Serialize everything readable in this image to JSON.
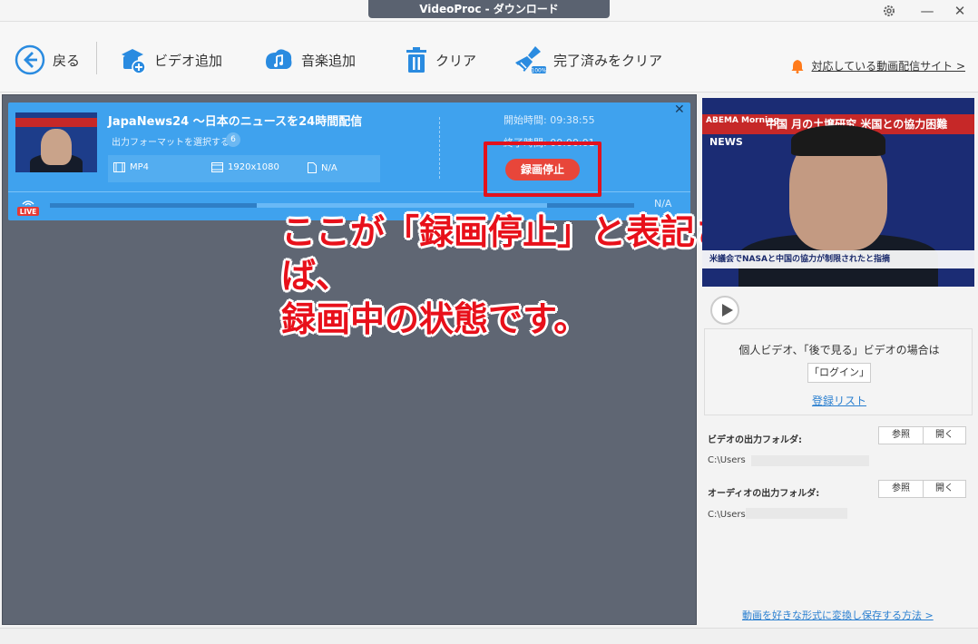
{
  "window": {
    "title": "VideoProc - ダウンロード"
  },
  "toolbar": {
    "back_label": "戻る",
    "add_video_label": "ビデオ追加",
    "add_music_label": "音楽追加",
    "clear_label": "クリア",
    "clear_done_label": "完了済みをクリア",
    "site_link": "対応している動画配信サイト >"
  },
  "task": {
    "title": "JapaNews24 〜日本のニュースを24時間配信",
    "format_label": "出力フォーマットを選択する",
    "format_count": "6",
    "container": "MP4",
    "resolution": "1920x1080",
    "size": "N/A",
    "start_time": "開始時間:  09:38:55",
    "end_time": "終了時間:  00:00:01",
    "stop_button": "録画停止",
    "progress_text": "N/A",
    "live_badge": "LIVE",
    "progress_fraction": 0.5
  },
  "annotation": {
    "text_line1": "ここが「録画停止」と表記されていれば、",
    "text_line2": "録画中の状態です。"
  },
  "preview": {
    "logo": "ABEMA Morning",
    "news_tag": "NEWS",
    "headline": "中国 月の土壌研究 米国との協力困難",
    "subtitle": "米議会でNASAと中国の協力が制限されたと指摘"
  },
  "side": {
    "login_hint": "個人ビデオ、「後で見る」ビデオの場合は",
    "login_button": "「ログイン」",
    "register_link": "登録リスト",
    "video_folder_label": "ビデオの出力フォルダ:",
    "audio_folder_label": "オーディオの出力フォルダ:",
    "browse_label": "参照",
    "open_label": "開く",
    "video_path": "C:\\Users",
    "audio_path": "C:\\Users",
    "bottom_link": "動画を好きな形式に変換し保存する方法 >"
  },
  "colors": {
    "accent": "#3fa2ee",
    "panel": "#5f6673",
    "stop": "#e8463a",
    "annotation": "#e8101a"
  }
}
